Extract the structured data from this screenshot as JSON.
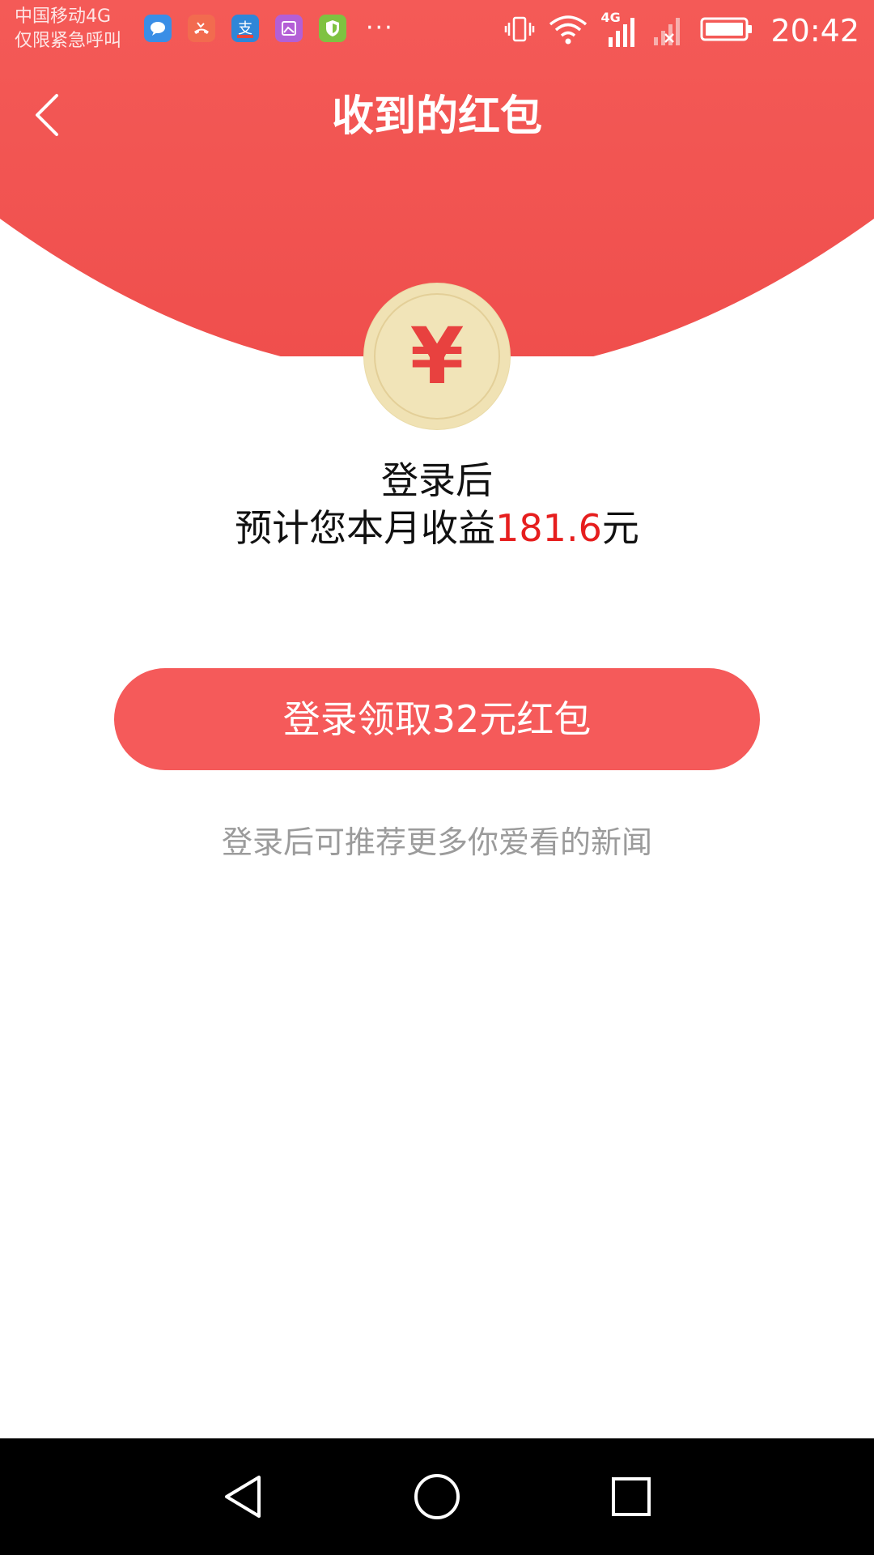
{
  "status_bar": {
    "carrier_line1": "中国移动4G",
    "carrier_line2": "仅限紧急呼叫",
    "network_badge": "4G",
    "time": "20:42",
    "notification_icons": [
      "message-icon",
      "missed-call-icon",
      "alipay-icon",
      "gallery-icon",
      "security-shield-icon"
    ],
    "more": "···",
    "icon_colors": {
      "message": "#3a8ee6",
      "missed_call": "#f26b4f",
      "alipay": "#2f86d8",
      "gallery": "#b45fd6",
      "security": "#7fc241"
    }
  },
  "header": {
    "title": "收到的红包",
    "back_icon": "chevron-left-icon",
    "color_top": "#f45a57",
    "color_bottom": "#ef4e4c"
  },
  "coin": {
    "symbol": "¥",
    "icon": "yuan-coin-icon"
  },
  "main": {
    "login_after": "登录后",
    "earnings_prefix": "预计您本月收益",
    "earnings_amount": "181.6",
    "earnings_suffix": "元",
    "claim_button": "登录领取32元红包",
    "hint": "登录后可推荐更多你爱看的新闻"
  },
  "nav_bar": {
    "buttons": [
      "back-triangle-icon",
      "home-circle-icon",
      "recents-square-icon"
    ]
  }
}
